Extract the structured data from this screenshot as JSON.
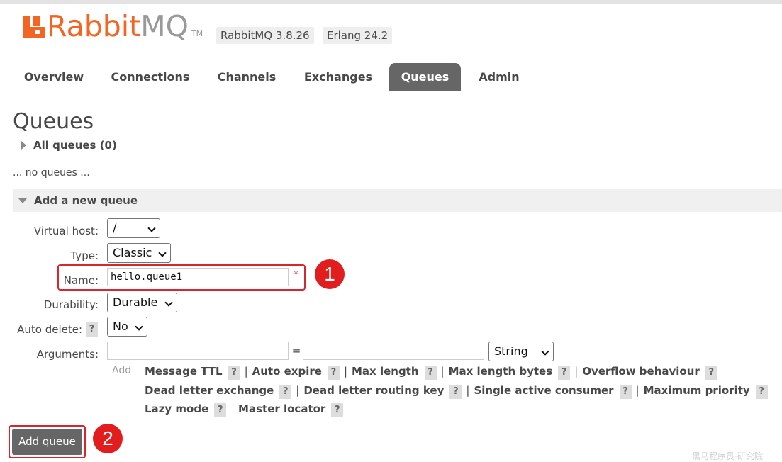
{
  "header": {
    "logo_primary": "Rabbit",
    "logo_secondary": "MQ",
    "logo_tm": "TM",
    "version_rabbit": "RabbitMQ 3.8.26",
    "version_erlang": "Erlang 24.2"
  },
  "nav": {
    "tabs": [
      {
        "label": "Overview"
      },
      {
        "label": "Connections"
      },
      {
        "label": "Channels"
      },
      {
        "label": "Exchanges"
      },
      {
        "label": "Queues",
        "active": true
      },
      {
        "label": "Admin"
      }
    ]
  },
  "page": {
    "title": "Queues",
    "all_queues_label": "All queues (0)",
    "no_queues_text": "... no queues ..."
  },
  "add_queue": {
    "section_label": "Add a new queue",
    "fields": {
      "virtual_host": {
        "label": "Virtual host:",
        "value": "/"
      },
      "type": {
        "label": "Type:",
        "value": "Classic"
      },
      "name": {
        "label": "Name:",
        "value": "hello.queue1",
        "required_mark": "*"
      },
      "durability": {
        "label": "Durability:",
        "value": "Durable"
      },
      "auto_delete": {
        "label": "Auto delete:",
        "help": "?",
        "value": "No"
      },
      "arguments": {
        "label": "Arguments:",
        "key_value": "",
        "equals": "=",
        "value_value": "",
        "type_value": "String"
      }
    },
    "add_label": "Add",
    "argument_links": {
      "row1": [
        "Message TTL",
        "Auto expire",
        "Max length",
        "Max length bytes",
        "Overflow behaviour"
      ],
      "row2": [
        "Dead letter exchange",
        "Dead letter routing key",
        "Single active consumer",
        "Maximum priority"
      ],
      "row3": [
        "Lazy mode",
        "Master locator"
      ]
    },
    "help_glyph": "?",
    "separator": "|",
    "submit_label": "Add queue"
  },
  "annotations": {
    "badge_1": "1",
    "badge_2": "2",
    "highlight_color": "#d8262f",
    "badge_color": "#e11d1d"
  },
  "watermark": "黑马程序员·研究院",
  "colors": {
    "brand_orange": "#f26522",
    "tab_active_bg": "#666666"
  }
}
